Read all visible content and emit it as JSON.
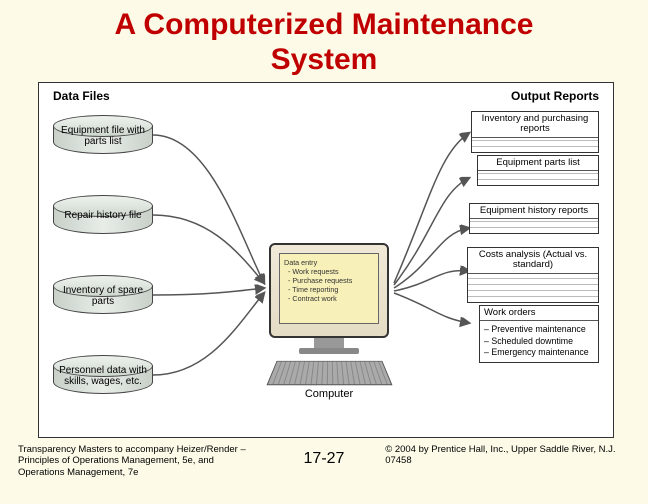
{
  "title_line1": "A Computerized Maintenance",
  "title_line2": "System",
  "heading_left": "Data Files",
  "heading_right": "Output Reports",
  "db": [
    {
      "label": "Equipment file with parts list"
    },
    {
      "label": "Repair history file"
    },
    {
      "label": "Inventory of spare parts"
    },
    {
      "label": "Personnel data with skills, wages, etc."
    }
  ],
  "computer": {
    "label": "Computer",
    "screen_title": "Data entry",
    "screen_items": [
      "Work requests",
      "Purchase requests",
      "Time reporting",
      "Contract work"
    ]
  },
  "reports": {
    "r1": "Inventory and purchasing reports",
    "r2": "Equipment parts list",
    "r3": "Equipment history reports",
    "r4": "Costs analysis (Actual vs. standard)",
    "wo_title": "Work orders",
    "wo_items": [
      "Preventive maintenance",
      "Scheduled downtime",
      "Emergency maintenance"
    ]
  },
  "footer": {
    "left": "Transparency Masters to accompany Heizer/Render – Principles of Operations Management, 5e, and Operations Management, 7e",
    "mid": "17-27",
    "right": "© 2004 by Prentice Hall, Inc., Upper Saddle River, N.J. 07458"
  }
}
